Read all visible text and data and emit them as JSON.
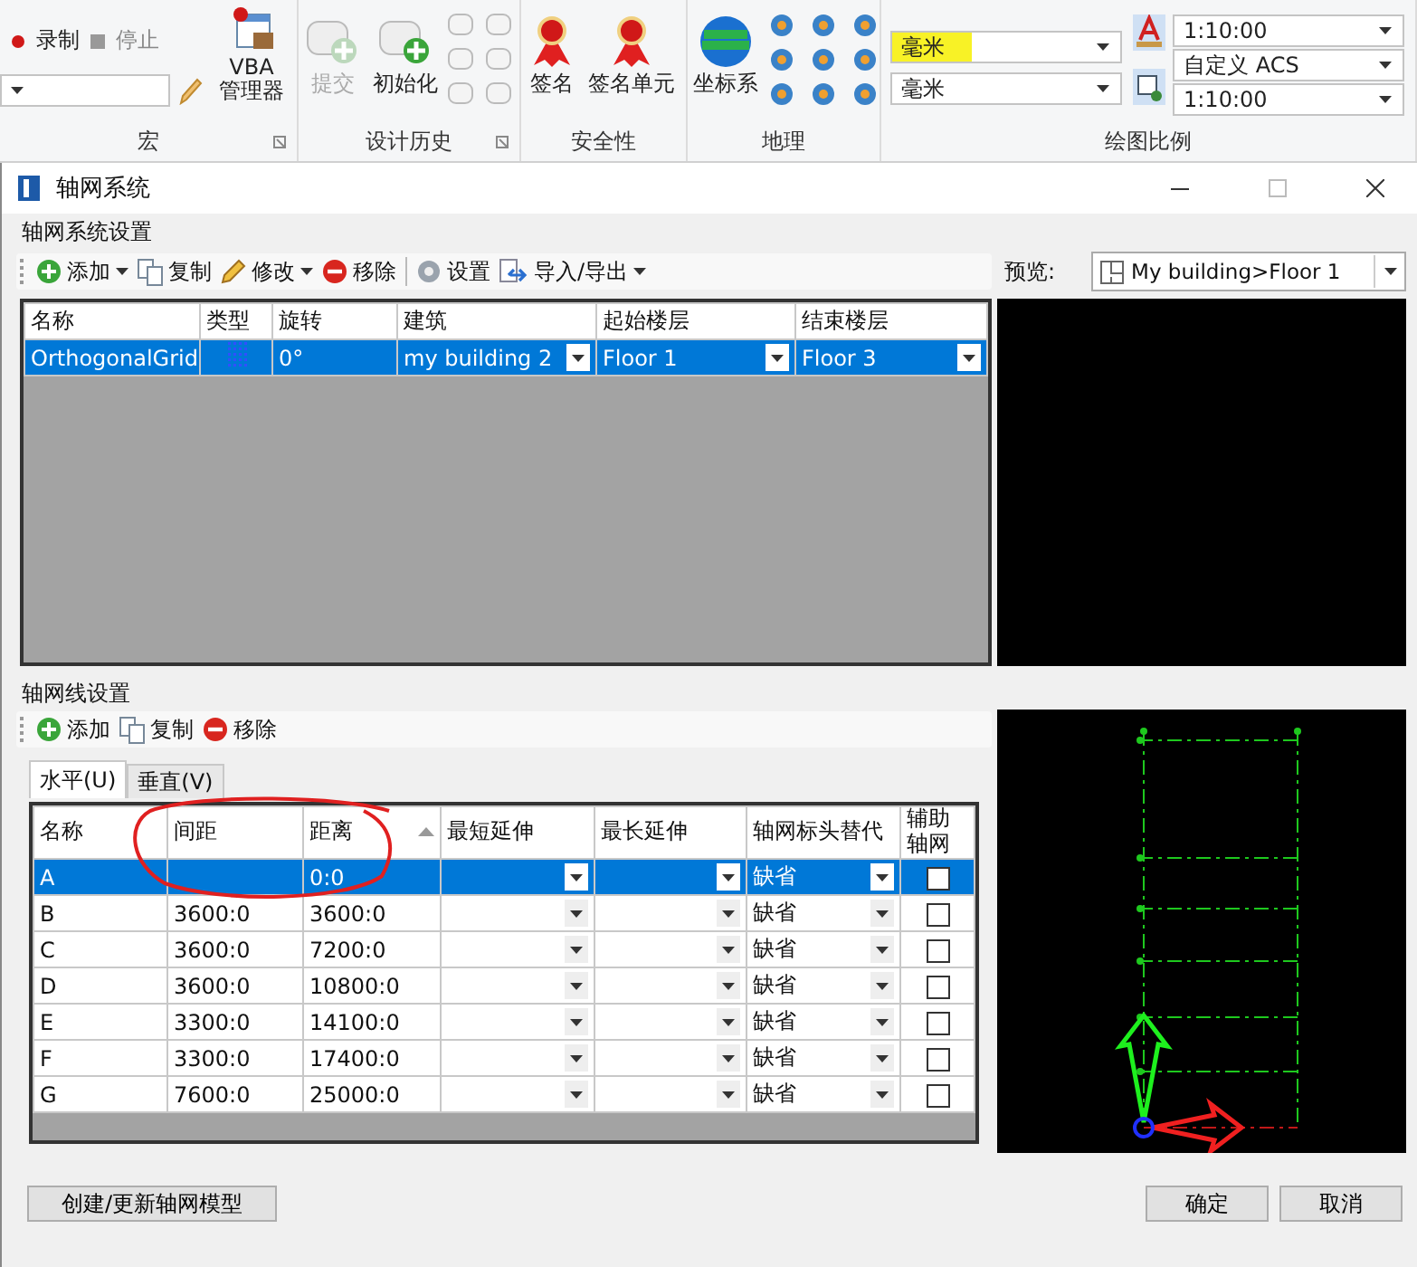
{
  "ribbon": {
    "groups": [
      {
        "kind": "macro",
        "label": "宏",
        "record": "录制",
        "stop": "停止",
        "vba": [
          "VBA",
          "管理器"
        ]
      },
      {
        "kind": "history",
        "label": "设计历史",
        "buttons": [
          {
            "label": "提交",
            "disabled": true
          },
          {
            "label": "初始化",
            "disabled": false
          }
        ]
      },
      {
        "kind": "security",
        "label": "安全性",
        "buttons": [
          "签名",
          "签名单元"
        ]
      },
      {
        "kind": "geo",
        "label": "地理",
        "button": "坐标系"
      },
      {
        "kind": "scale",
        "label": "绘图比例",
        "units": [
          {
            "value": "毫米",
            "highlighted": true
          },
          {
            "value": "毫米",
            "highlighted": false
          }
        ],
        "scales": [
          "1:10:00",
          "自定义 ACS",
          "1:10:00"
        ]
      }
    ]
  },
  "dialog": {
    "title": "轴网系统",
    "systems": {
      "legend": "轴网系统设置",
      "toolbar": [
        {
          "kind": "add",
          "label": "添加",
          "menu": true
        },
        {
          "kind": "copy",
          "label": "复制",
          "menu": false
        },
        {
          "kind": "edit",
          "label": "修改",
          "menu": true
        },
        {
          "kind": "remove",
          "label": "移除",
          "menu": false
        },
        {
          "kind": "gear",
          "label": "设置",
          "menu": false
        },
        {
          "kind": "import",
          "label": "导入/导出",
          "menu": true
        }
      ],
      "columns": [
        "名称",
        "类型",
        "旋转",
        "建筑",
        "起始楼层",
        "结束楼层"
      ],
      "rows": [
        {
          "selected": true,
          "name": "OrthogonalGrid",
          "rotation": "0°",
          "building": "my building 2",
          "start_floor": "Floor 1",
          "end_floor": "Floor 3"
        }
      ]
    },
    "preview": {
      "label": "预览:",
      "view": "My building>Floor 1"
    },
    "lines": {
      "legend": "轴网线设置",
      "toolbar": [
        {
          "kind": "add",
          "label": "添加",
          "menu": false
        },
        {
          "kind": "copy",
          "label": "复制",
          "menu": false
        },
        {
          "kind": "remove",
          "label": "移除",
          "menu": false
        }
      ],
      "tabs": [
        {
          "label": "水平(U)",
          "selected": true
        },
        {
          "label": "垂直(V)",
          "selected": false
        }
      ],
      "columns": [
        {
          "label": "名称",
          "sorted": false
        },
        {
          "label": "间距",
          "sorted": false
        },
        {
          "label": "距离",
          "sorted": true
        },
        {
          "label": "最短延伸",
          "sorted": false
        },
        {
          "label": "最长延伸",
          "sorted": false
        },
        {
          "label": "轴网标头替代",
          "sorted": false
        },
        {
          "label": "辅助轴网",
          "sorted": false
        }
      ],
      "rows": [
        {
          "name": "A",
          "distance": "0:0",
          "head": "缺省",
          "aux": false,
          "selected": true
        },
        {
          "name": "B",
          "spacing": "3600:0",
          "distance": "3600:0",
          "head": "缺省",
          "aux": false,
          "selected": false
        },
        {
          "name": "C",
          "spacing": "3600:0",
          "distance": "7200:0",
          "head": "缺省",
          "aux": false,
          "selected": false
        },
        {
          "name": "D",
          "spacing": "3600:0",
          "distance": "10800:0",
          "head": "缺省",
          "aux": false,
          "selected": false
        },
        {
          "name": "E",
          "spacing": "3300:0",
          "distance": "14100:0",
          "head": "缺省",
          "aux": false,
          "selected": false
        },
        {
          "name": "F",
          "spacing": "3300:0",
          "distance": "17400:0",
          "head": "缺省",
          "aux": false,
          "selected": false
        },
        {
          "name": "G",
          "spacing": "7600:0",
          "distance": "25000:0",
          "head": "缺省",
          "aux": false,
          "selected": false
        }
      ]
    },
    "buttons": [
      {
        "kind": "create",
        "label": "创建/更新轴网模型"
      },
      {
        "kind": "ok",
        "label": "确定"
      },
      {
        "kind": "cancel",
        "label": "取消"
      }
    ]
  }
}
